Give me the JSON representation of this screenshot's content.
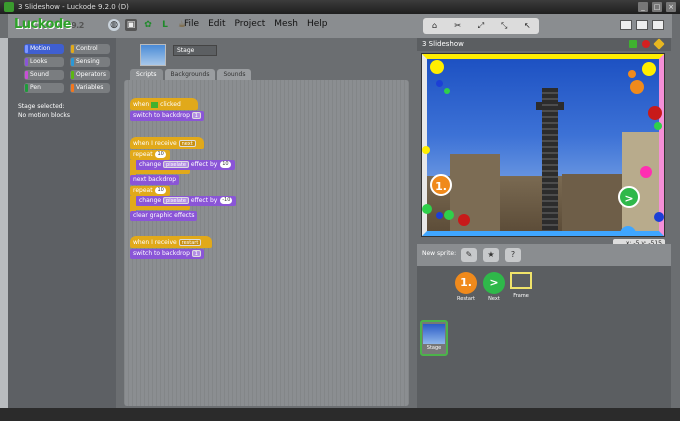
{
  "window": {
    "title": "3 Slideshow - Luckode 9.2.0 (D)",
    "buttons": [
      "_",
      "□",
      "×"
    ]
  },
  "app": {
    "logo_text": "Luckode",
    "logo_version": "9.2"
  },
  "toolbar": {
    "icons": [
      "globe-icon",
      "save-icon",
      "settings-icon",
      "language-icon",
      "extension-icon"
    ]
  },
  "menu": {
    "file": "File",
    "edit": "Edit",
    "project": "Project",
    "mesh": "Mesh",
    "help": "Help"
  },
  "categories": {
    "motion": "Motion",
    "control": "Control",
    "looks": "Looks",
    "sensing": "Sensing",
    "sound": "Sound",
    "operators": "Operators",
    "pen": "Pen",
    "variables": "Variables",
    "selected": "Motion"
  },
  "left_info": {
    "line1": "Stage selected:",
    "line2": "No motion blocks"
  },
  "sprite": {
    "name": "Stage"
  },
  "tabs": {
    "scripts": "Scripts",
    "backgrounds": "Backgrounds",
    "sounds": "Sounds",
    "active": "Scripts"
  },
  "script1": {
    "hat_when": "when",
    "hat_clicked": "clicked",
    "switch": "switch to backdrop",
    "switch_value": "1"
  },
  "script2": {
    "hat": "when I receive",
    "hat_value": "next",
    "repeat1": "repeat",
    "repeat1_count": "10",
    "change1": "change",
    "change1_effect": "pixelate",
    "change1_mid": "effect by",
    "change1_value": "10",
    "next_backdrop": "next backdrop",
    "repeat2": "repeat",
    "repeat2_count": "10",
    "change2": "change",
    "change2_effect": "pixelate",
    "change2_mid": "effect by",
    "change2_value": "-10",
    "clear": "clear graphic effects"
  },
  "script3": {
    "hat": "when I receive",
    "hat_value": "restart",
    "switch": "switch to backdrop",
    "switch_value": "1"
  },
  "stage": {
    "title": "3 Slideshow",
    "x_label": "x:",
    "x_value": "-5",
    "y_label": "y:",
    "y_value": "-515",
    "restart_glyph": "1.",
    "next_glyph": ">"
  },
  "new_sprite": {
    "label": "New sprite:"
  },
  "sprites": [
    {
      "name": "Restart",
      "glyph": "1.",
      "color": "#f08a1c"
    },
    {
      "name": "Next",
      "glyph": ">",
      "color": "#2fb84a"
    },
    {
      "name": "Frame",
      "glyph": "",
      "color": "#f0e36a"
    }
  ],
  "stage_thumb": {
    "label": "Stage"
  },
  "colors": {
    "motion": "#3f5fd1",
    "control": "#e1a91a",
    "looks": "#8a55d7",
    "sound": "#c84fd6",
    "pen": "#1e9a3a",
    "sensing": "#2a98d6",
    "operators": "#5cb712",
    "variables": "#f3761d",
    "green_flag": "#3fb12f",
    "stop": "#d42020"
  }
}
